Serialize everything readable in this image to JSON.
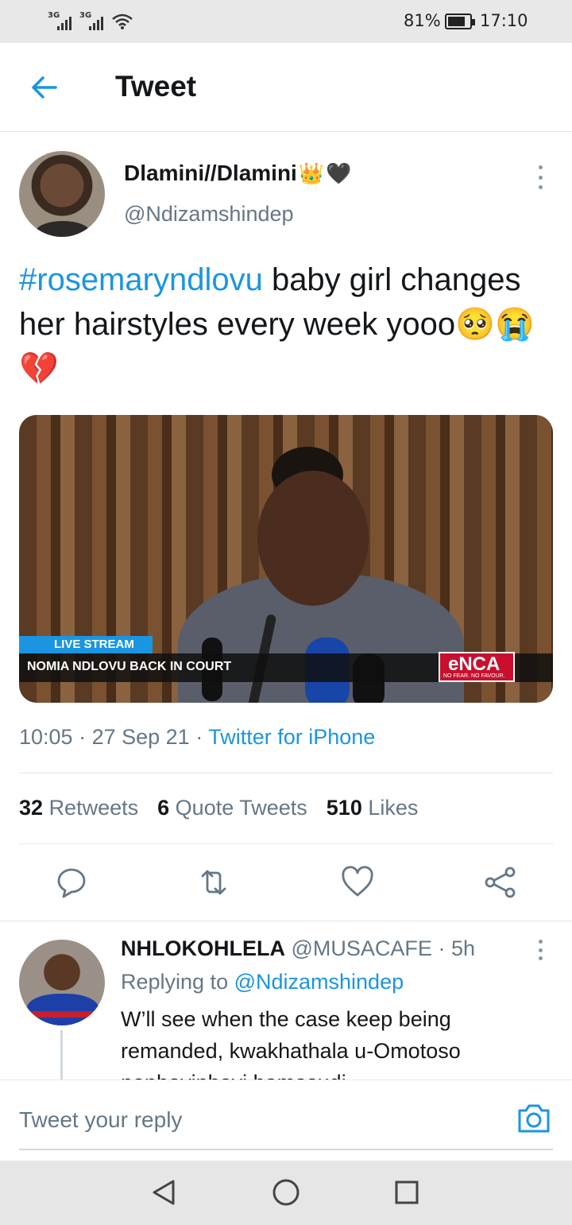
{
  "status_bar": {
    "sim1": "3G",
    "sim2": "3G",
    "battery_percent_text": "81%",
    "battery_level": 0.81,
    "time": "17:10"
  },
  "header": {
    "title": "Tweet",
    "back_icon": "arrow-left-icon"
  },
  "tweet": {
    "author_name": "Dlamini//Dlamini",
    "author_emoji_crown": "👑",
    "author_emoji_heart": "🖤",
    "author_handle": "@Ndizamshindep",
    "hashtag": "#rosemaryndlovu",
    "text": " baby girl changes her hairstyles every week yooo🥺😭💔",
    "media": {
      "live_label": "LIVE STREAM",
      "headline": "NOMIA NDLOVU BACK IN COURT",
      "channel_logo": "eNCA",
      "channel_tagline": "NO FEAR. NO FAVOUR."
    },
    "time": "10:05",
    "date": "27 Sep 21",
    "source": "Twitter for iPhone",
    "stats": {
      "retweets_count": "32",
      "retweets_label": "Retweets",
      "quotes_count": "6",
      "quotes_label": "Quote Tweets",
      "likes_count": "510",
      "likes_label": "Likes"
    },
    "actions": [
      "reply-icon",
      "retweet-icon",
      "like-icon",
      "share-icon"
    ]
  },
  "reply": {
    "author_name": "NHLOKOHLELA",
    "author_handle": "@MUSACAFE",
    "age": "5h",
    "replying_prefix": "Replying to ",
    "replying_to": "@Ndizamshindep",
    "text": "W’ll see when the case keep being remanded, kwakhathala u-Omotoso nonhavinhavi hamasudi"
  },
  "composer": {
    "placeholder": "Tweet your reply",
    "camera_icon": "camera-icon"
  },
  "navbar": {
    "icons": [
      "back-triangle-icon",
      "home-circle-icon",
      "recents-square-icon"
    ]
  },
  "colors": {
    "accent": "#1b95e0",
    "text": "#14171a",
    "muted": "#657786",
    "divider": "#e1e8ed"
  }
}
